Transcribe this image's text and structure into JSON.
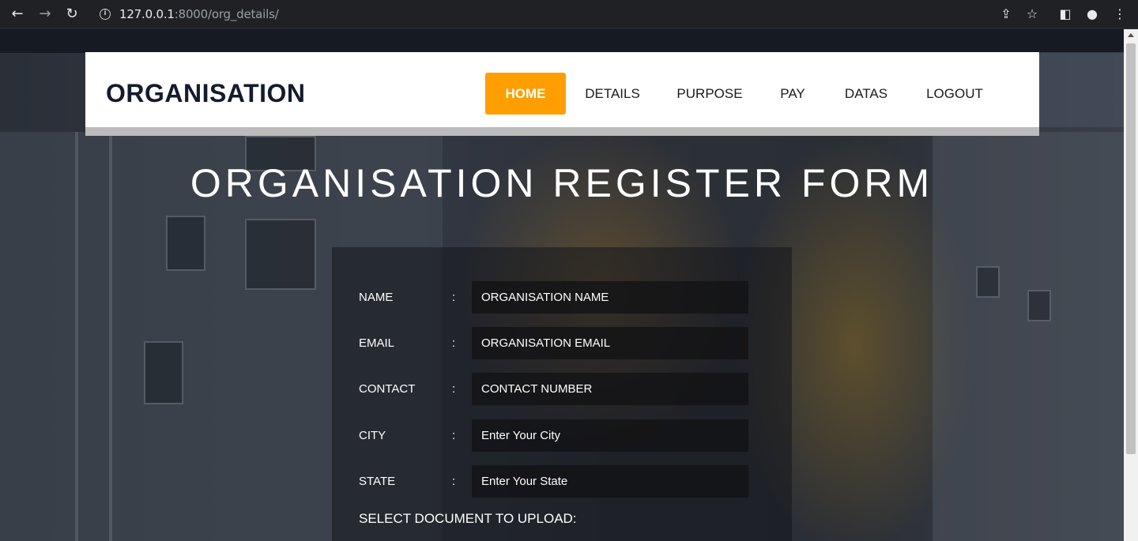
{
  "browser": {
    "url_host": "127.0.0.1",
    "url_rest": ":8000/org_details/"
  },
  "header": {
    "brand": "ORGANISATION",
    "nav": [
      {
        "label": "HOME",
        "active": true
      },
      {
        "label": "DETAILS",
        "active": false
      },
      {
        "label": "PURPOSE",
        "active": false
      },
      {
        "label": "PAY",
        "active": false
      },
      {
        "label": "DATAS",
        "active": false
      },
      {
        "label": "LOGOUT",
        "active": false
      }
    ]
  },
  "page": {
    "title": "ORGANISATION REGISTER FORM"
  },
  "form": {
    "colon": ":",
    "fields": [
      {
        "label": "NAME",
        "placeholder": "ORGANISATION NAME"
      },
      {
        "label": "EMAIL",
        "placeholder": "ORGANISATION EMAIL"
      },
      {
        "label": "CONTACT",
        "placeholder": "CONTACT NUMBER"
      },
      {
        "label": "CITY",
        "placeholder": "Enter Your City"
      },
      {
        "label": "STATE",
        "placeholder": "Enter Your State"
      }
    ],
    "upload_label": "SELECT DOCUMENT TO UPLOAD:"
  },
  "colors": {
    "accent": "#ff9e00",
    "brand_text": "#141b2d"
  }
}
